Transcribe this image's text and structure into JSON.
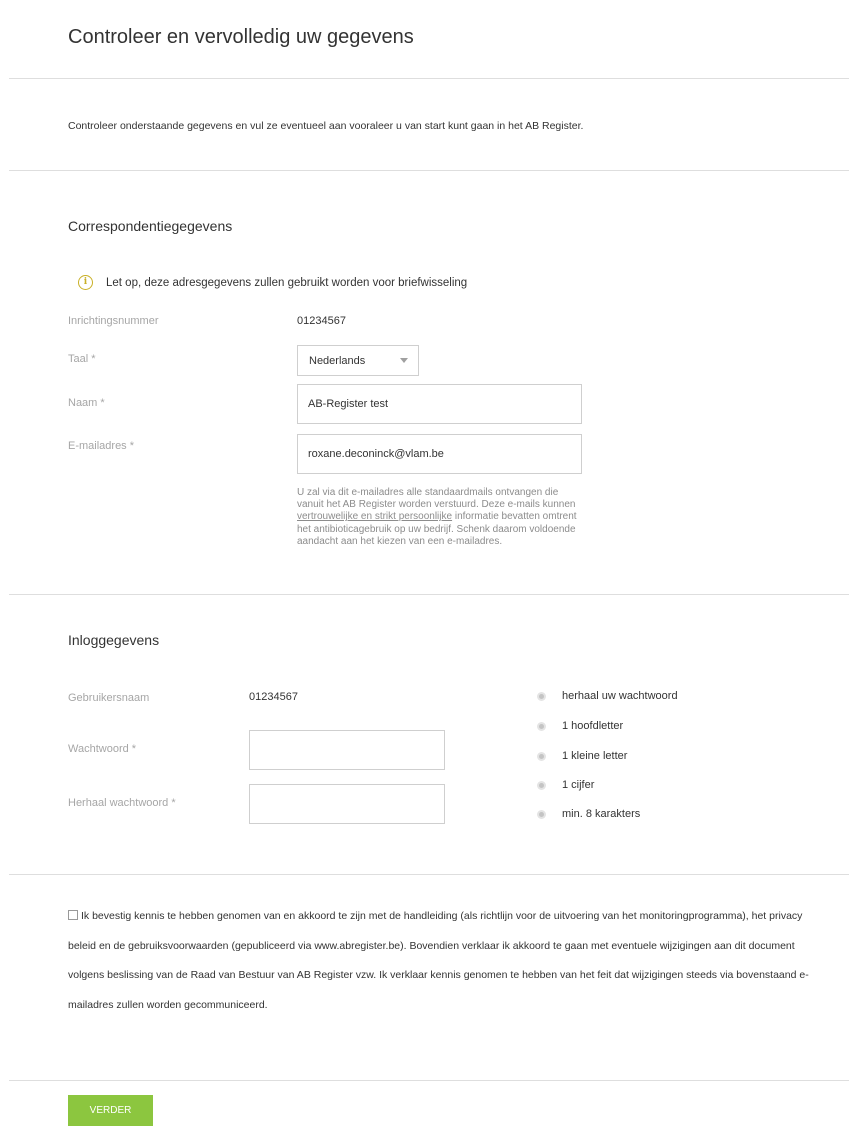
{
  "page": {
    "title": "Controleer en vervolledig uw gegevens"
  },
  "intro": "Controleer onderstaande gegevens en vul ze eventueel aan vooraleer u van start kunt gaan in het AB Register.",
  "correspondentie": {
    "title": "Correspondentiegegevens",
    "notice": "Let op, deze adresgegevens zullen gebruikt worden voor briefwisseling",
    "inrichtingsnummer": {
      "label": "Inrichtingsnummer",
      "value": "01234567"
    },
    "taal": {
      "label": "Taal *",
      "value": "Nederlands"
    },
    "naam": {
      "label": "Naam *",
      "value": "AB-Register test"
    },
    "email": {
      "label": "E-mailadres *",
      "value": "roxane.deconinck@vlam.be",
      "help_before": "U zal via dit e-mailadres alle standaardmails ontvangen die vanuit het AB Register worden verstuurd. Deze e-mails kunnen ",
      "help_underlined": "vertrouwelijke en strikt persoonlijke",
      "help_after": " informatie bevatten omtrent het antibioticagebruik op uw bedrijf. Schenk daarom voldoende aandacht aan het kiezen van een e-mailadres."
    }
  },
  "inlog": {
    "title": "Inloggegevens",
    "gebruikersnaam": {
      "label": "Gebruikersnaam",
      "value": "01234567"
    },
    "wachtwoord": {
      "label": "Wachtwoord *",
      "value": ""
    },
    "herhaal": {
      "label": "Herhaal wachtwoord *",
      "value": ""
    },
    "requirements": [
      "herhaal uw wachtwoord",
      "1 hoofdletter",
      "1 kleine letter",
      "1 cijfer",
      "min. 8 karakters"
    ]
  },
  "agreement": {
    "checked": false,
    "text": "Ik bevestig kennis te hebben genomen van en akkoord te zijn met de handleiding (als richtlijn voor de uitvoering van het monitoringprogramma), het privacy beleid en de gebruiksvoorwaarden (gepubliceerd via www.abregister.be). Bovendien verklaar ik akkoord te gaan met eventuele wijzigingen aan dit document volgens beslissing van de Raad van Bestuur van AB Register vzw. Ik verklaar kennis genomen te hebben van het feit dat wijzigingen steeds via bovenstaand e-mailadres zullen worden gecommuniceerd."
  },
  "buttons": {
    "verder": "VERDER"
  },
  "colors": {
    "accent": "#8cc63f",
    "notice_icon": "#c9b027",
    "label": "#a6a6a6",
    "divider": "#dedede"
  }
}
